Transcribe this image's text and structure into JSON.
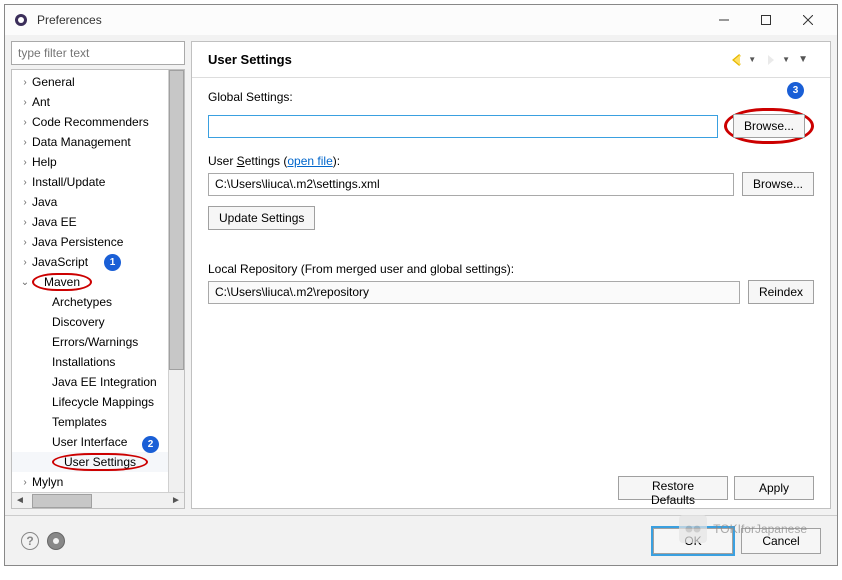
{
  "window": {
    "title": "Preferences"
  },
  "filter_placeholder": "type filter text",
  "tree": {
    "items": [
      {
        "label": "General",
        "expanded": false,
        "level": 1
      },
      {
        "label": "Ant",
        "expanded": false,
        "level": 1
      },
      {
        "label": "Code Recommenders",
        "expanded": false,
        "level": 1
      },
      {
        "label": "Data Management",
        "expanded": false,
        "level": 1
      },
      {
        "label": "Help",
        "expanded": false,
        "level": 1
      },
      {
        "label": "Install/Update",
        "expanded": false,
        "level": 1
      },
      {
        "label": "Java",
        "expanded": false,
        "level": 1
      },
      {
        "label": "Java EE",
        "expanded": false,
        "level": 1
      },
      {
        "label": "Java Persistence",
        "expanded": false,
        "level": 1
      },
      {
        "label": "JavaScript",
        "expanded": false,
        "level": 1
      },
      {
        "label": "Maven",
        "expanded": true,
        "level": 1,
        "circled": true
      },
      {
        "label": "Archetypes",
        "level": 2
      },
      {
        "label": "Discovery",
        "level": 2
      },
      {
        "label": "Errors/Warnings",
        "level": 2
      },
      {
        "label": "Installations",
        "level": 2
      },
      {
        "label": "Java EE Integration",
        "level": 2
      },
      {
        "label": "Lifecycle Mappings",
        "level": 2
      },
      {
        "label": "Templates",
        "level": 2
      },
      {
        "label": "User Interface",
        "level": 2
      },
      {
        "label": "User Settings",
        "level": 2,
        "circled": true,
        "selected": true
      },
      {
        "label": "Mylyn",
        "expanded": false,
        "level": 1
      }
    ]
  },
  "annotations": {
    "a1": "1",
    "a2": "2",
    "a3": "3"
  },
  "main": {
    "heading": "User Settings",
    "global_settings_label": "Global Settings:",
    "global_settings_value": "",
    "browse_label": "Browse...",
    "user_settings_label_pre": "User ",
    "user_settings_label_ul": "S",
    "user_settings_label_post": "ettings (",
    "open_file": "open file",
    "user_settings_label_end": "):",
    "user_settings_value": "C:\\Users\\liuca\\.m2\\settings.xml",
    "update_settings": "Update Settings",
    "local_repo_label": "Local Repository (From merged user and global settings):",
    "local_repo_value": "C:\\Users\\liuca\\.m2\\repository",
    "reindex": "Reindex",
    "restore_defaults": "Restore Defaults",
    "apply": "Apply"
  },
  "footer": {
    "ok": "OK",
    "cancel": "Cancel",
    "help_icon": "?"
  },
  "watermark": "TOKIforJapanese"
}
